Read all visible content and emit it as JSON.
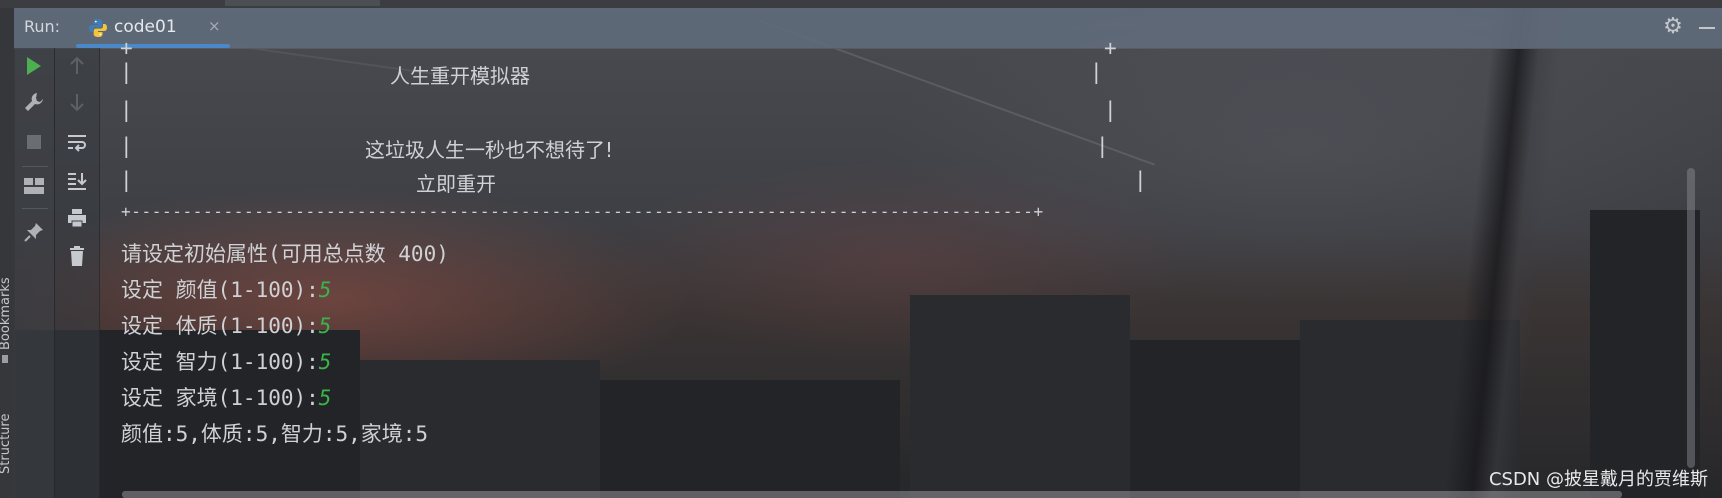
{
  "run_panel": {
    "label": "Run:",
    "tab_title": "code01",
    "tab_close": "×",
    "tab_icon": "python-icon",
    "accent_color": "#4a88c7",
    "input_color": "#3bb54a"
  },
  "side_stripe": {
    "bookmarks": "Bookmarks",
    "structure": "Structure"
  },
  "toolbar_left": [
    "run-icon",
    "wrench-icon",
    "stop-icon",
    "layout-icon",
    "pin-icon"
  ],
  "toolbar_right": [
    "up-arrow-icon",
    "down-arrow-icon",
    "soft-wrap-icon",
    "scroll-to-end-icon",
    "print-icon",
    "trash-icon"
  ],
  "console": {
    "box_top": "+",
    "title": "人生重开模拟器",
    "slogan": "这垃圾人生一秒也不想待了!",
    "restart": "立即重开",
    "separator": "+----------------------------------------------------------------------------------------+",
    "prompt": "请设定初始属性(可用总点数 400)",
    "settings": [
      {
        "label": "设定 颜值(1-100):",
        "value": "5"
      },
      {
        "label": "设定 体质(1-100):",
        "value": "5"
      },
      {
        "label": "设定 智力(1-100):",
        "value": "5"
      },
      {
        "label": "设定 家境(1-100):",
        "value": "5"
      }
    ],
    "summary": "颜值:5,体质:5,智力:5,家境:5"
  },
  "watermark": "CSDN @披星戴月的贾维斯"
}
